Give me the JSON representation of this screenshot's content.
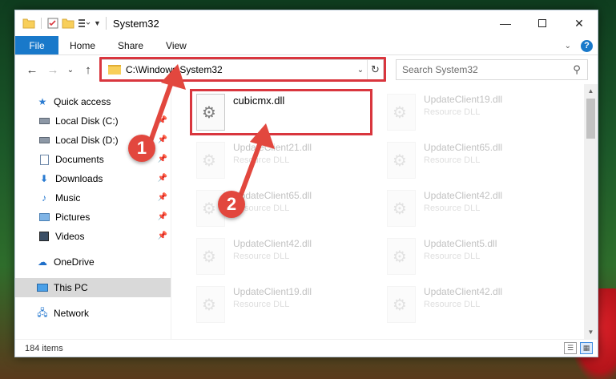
{
  "window": {
    "title": "System32"
  },
  "ribbon": {
    "file": "File",
    "tabs": [
      "Home",
      "Share",
      "View"
    ],
    "help": "?"
  },
  "address": {
    "path": "C:\\Windows\\System32"
  },
  "search": {
    "placeholder": "Search System32"
  },
  "sidebar": {
    "items": [
      {
        "label": "Quick access",
        "icon": "star-icon"
      },
      {
        "label": "Local Disk (C:)",
        "icon": "drive-icon",
        "pinned": true
      },
      {
        "label": "Local Disk (D:)",
        "icon": "drive-icon",
        "pinned": true
      },
      {
        "label": "Documents",
        "icon": "documents-icon",
        "pinned": true
      },
      {
        "label": "Downloads",
        "icon": "download-icon",
        "pinned": true
      },
      {
        "label": "Music",
        "icon": "music-icon",
        "pinned": true
      },
      {
        "label": "Pictures",
        "icon": "pictures-icon",
        "pinned": true
      },
      {
        "label": "Videos",
        "icon": "videos-icon",
        "pinned": true
      },
      {
        "label": "OneDrive",
        "icon": "cloud-icon"
      },
      {
        "label": "This PC",
        "icon": "computer-icon",
        "selected": true
      },
      {
        "label": "Network",
        "icon": "network-icon"
      }
    ]
  },
  "files": {
    "main": {
      "name": "cubicmx.dll"
    },
    "grid": [
      {
        "name": "UpdateClient19.dll",
        "type": "Resource DLL"
      },
      {
        "name": "UpdateClient21.dll",
        "type": "Resource DLL"
      },
      {
        "name": "UpdateClient65.dll",
        "type": "Resource DLL"
      },
      {
        "name": "UpdateClient65.dll",
        "type": "Resource DLL"
      },
      {
        "name": "UpdateClient42.dll",
        "type": "Resource DLL"
      },
      {
        "name": "UpdateClient42.dll",
        "type": "Resource DLL"
      },
      {
        "name": "UpdateClient5.dll",
        "type": "Resource DLL"
      },
      {
        "name": "UpdateClient19.dll",
        "type": "Resource DLL"
      },
      {
        "name": "UpdateClient42.dll",
        "type": "Resource DLL"
      }
    ]
  },
  "status": {
    "count": "184 items"
  },
  "callouts": [
    "1",
    "2"
  ],
  "colors": {
    "accent": "#1979ca",
    "highlight": "#d9363e",
    "callout": "#e2473e"
  }
}
